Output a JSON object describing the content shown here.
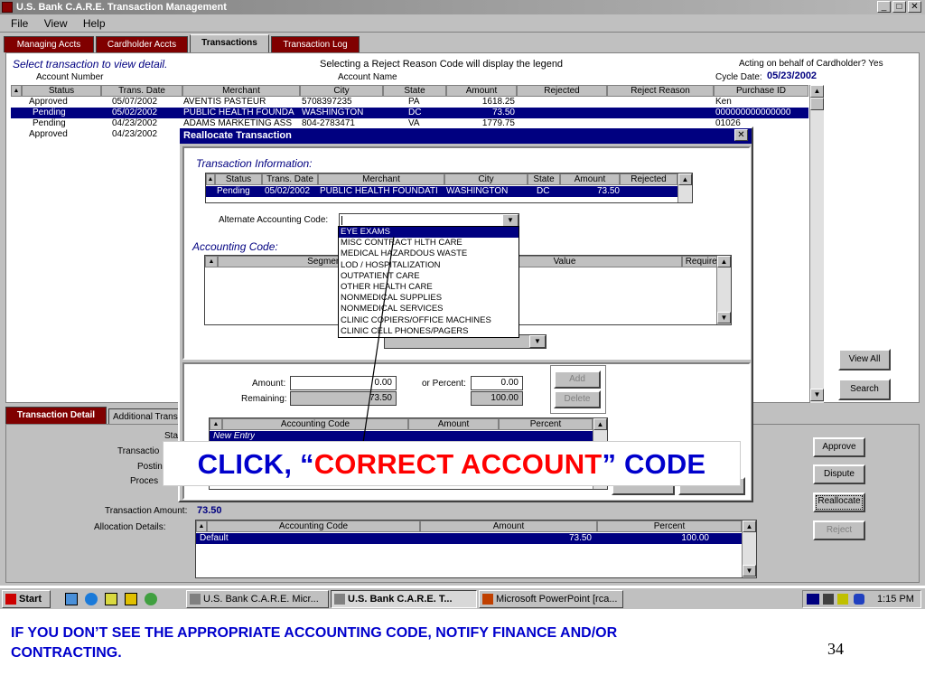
{
  "window": {
    "title": "U.S. Bank C.A.R.E. Transaction Management"
  },
  "menu": [
    "File",
    "View",
    "Help"
  ],
  "tabs": [
    "Managing Accts",
    "Cardholder Accts",
    "Transactions",
    "Transaction Log"
  ],
  "header": {
    "select_prompt": "Select transaction to view detail.",
    "reject_legend": "Selecting a Reject Reason Code will display the legend",
    "acting_on_behalf": "Acting on behalf of Cardholder?",
    "acting_value": "Yes",
    "account_number_label": "Account Number",
    "account_name_label": "Account Name",
    "cycle_date_label": "Cycle Date:",
    "cycle_date_value": "05/23/2002"
  },
  "main_table": {
    "columns": [
      "Status",
      "Trans. Date",
      "Merchant",
      "City",
      "State",
      "Amount",
      "Rejected",
      "Reject Reason",
      "Purchase ID"
    ],
    "rows": [
      [
        "Approved",
        "05/07/2002",
        "AVENTIS PASTEUR",
        "5708397235",
        "PA",
        "1618.25",
        "",
        "",
        "Ken"
      ],
      [
        "Pending",
        "05/02/2002",
        "PUBLIC HEALTH FOUNDA",
        "WASHINGTON",
        "DC",
        "73.50",
        "",
        "",
        "000000000000000"
      ],
      [
        "Pending",
        "04/23/2002",
        "ADAMS MARKETING ASS",
        "804-2783471",
        "VA",
        "1779.75",
        "",
        "",
        "01026"
      ],
      [
        "Approved",
        "04/23/2002",
        "",
        "",
        "",
        "",
        "",
        "",
        ""
      ]
    ]
  },
  "right_buttons": {
    "view_all": "View All",
    "search": "Search"
  },
  "bottom_tabs": [
    "Transaction Detail",
    "Additional Trans"
  ],
  "detail": {
    "status_label": "Sta",
    "transaction_label": "Transactio",
    "posting_label": "Postin",
    "process_label": "Proces",
    "transaction_amount_label": "Transaction Amount:",
    "transaction_amount_value": "73.50",
    "allocation_label": "Allocation Details:",
    "alloc_columns": [
      "Accounting Code",
      "Amount",
      "Percent"
    ],
    "alloc_rows": [
      [
        "Default",
        "73.50",
        "100.00"
      ]
    ]
  },
  "side_buttons": {
    "approve": "Approve",
    "dispute": "Dispute",
    "reallocate": "Reallocate",
    "reject": "Reject"
  },
  "dialog": {
    "title": "Reallocate Transaction",
    "transaction_info_title": "Transaction Information:",
    "info_columns": [
      "Status",
      "Trans. Date",
      "Merchant",
      "City",
      "State",
      "Amount",
      "Rejected"
    ],
    "info_row": [
      "Pending",
      "05/02/2002",
      "PUBLIC HEALTH FOUNDATI",
      "WASHINGTON",
      "DC",
      "73.50",
      ""
    ],
    "alt_code_label": "Alternate Accounting Code:",
    "accounting_code_title": "Accounting Code:",
    "segment_columns": [
      "Segment Na",
      "Value",
      "Required"
    ],
    "dropdown_options": [
      "EYE EXAMS",
      "MISC CONTRACT HLTH CARE",
      "MEDICAL HAZARDOUS WASTE",
      "LOD / HOSPITALIZATION",
      "OUTPATIENT CARE",
      "OTHER HEALTH CARE",
      "NONMEDICAL SUPPLIES",
      "NONMEDICAL SERVICES",
      "CLINIC COPIERS/OFFICE MACHINES",
      "CLINIC CELL PHONES/PAGERS"
    ],
    "amount_label": "Amount:",
    "amount_value": "0.00",
    "percent_label": "or Percent:",
    "percent_value": "0.00",
    "remaining_label": "Remaining:",
    "remaining_amount": "73.50",
    "remaining_percent": "100.00",
    "add_button": "Add",
    "delete_button": "Delete",
    "entry_columns": [
      "Accounting Code",
      "Amount",
      "Percent"
    ],
    "new_entry": "New Entry"
  },
  "callout": {
    "prefix": "CLICK, “",
    "highlight": "CORRECT ACCOUNT",
    "suffix": "” CODE"
  },
  "taskbar": {
    "start": "Start",
    "tasks": [
      "U.S. Bank C.A.R.E.  Micr...",
      "U.S. Bank C.A.R.E. T...",
      "Microsoft PowerPoint  [rca..."
    ],
    "clock": "1:15 PM"
  },
  "note": "IF YOU DON’T SEE THE APPROPRIATE ACCOUNTING CODE, NOTIFY FINANCE AND/OR CONTRACTING.",
  "page_number": "34",
  "colors": {
    "selection": "#000080",
    "tab_active": "#800000",
    "callout_blue": "#0000cc",
    "callout_red": "#ff0000"
  }
}
